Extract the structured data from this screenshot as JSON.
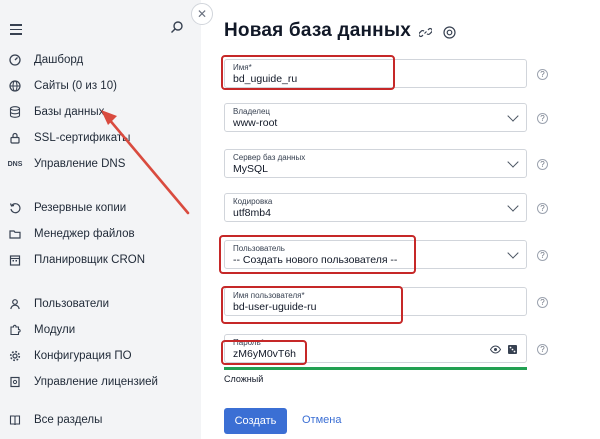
{
  "sidebar": {
    "items": [
      {
        "label": "Дашборд",
        "icon": "dashboard-icon"
      },
      {
        "label": "Сайты (0 из 10)",
        "icon": "globe-icon"
      },
      {
        "label": "Базы данных",
        "icon": "database-icon"
      },
      {
        "label": "SSL-сертификаты",
        "icon": "lock-icon"
      },
      {
        "label": "Управление DNS",
        "icon": "dns-icon"
      },
      {
        "label": "Резервные копии",
        "icon": "backup-icon"
      },
      {
        "label": "Менеджер файлов",
        "icon": "folder-icon"
      },
      {
        "label": "Планировщик CRON",
        "icon": "calendar-icon"
      },
      {
        "label": "Пользователи",
        "icon": "user-icon"
      },
      {
        "label": "Модули",
        "icon": "puzzle-icon"
      },
      {
        "label": "Конфигурация ПО",
        "icon": "gear-icon"
      },
      {
        "label": "Управление лицензией",
        "icon": "license-icon"
      },
      {
        "label": "Все разделы",
        "icon": "book-icon"
      }
    ]
  },
  "header": {
    "title": "Новая база данных"
  },
  "form": {
    "name": {
      "label": "Имя*",
      "value": "bd_uguide_ru"
    },
    "owner": {
      "label": "Владелец",
      "value": "www-root"
    },
    "server": {
      "label": "Сервер баз данных",
      "value": "MySQL"
    },
    "encoding": {
      "label": "Кодировка",
      "value": "utf8mb4"
    },
    "user": {
      "label": "Пользователь",
      "value": "-- Создать нового пользователя --"
    },
    "username": {
      "label": "Имя пользователя*",
      "value": "bd-user-uguide-ru"
    },
    "password": {
      "label": "Пароль*",
      "value": "zM6yM0vT6h"
    },
    "strength_label": "Сложный",
    "help_glyph": "?"
  },
  "actions": {
    "create_label": "Создать",
    "cancel_label": "Отмена"
  },
  "colors": {
    "accent": "#3b6fd4",
    "highlight": "#c62828",
    "strength": "#22a052"
  }
}
